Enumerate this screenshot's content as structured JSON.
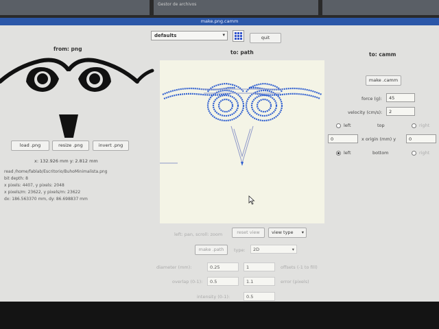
{
  "background_window": {
    "title": "Gestor de archivos"
  },
  "window": {
    "title": "make.png.camm"
  },
  "toolbar": {
    "preset": "defaults",
    "quit_label": "quit"
  },
  "from_panel": {
    "heading": "from: png",
    "load_label": "load .png",
    "resize_label": "resize .png",
    "invert_label": "invert .png",
    "coords": "x: 132.926 mm  y: 2.812 mm",
    "info": [
      "read /home/fablab/Escritorio/BuhoMinimalista.png",
      "bit depth: 8",
      "x pixels: 4407, y pixels: 2048",
      "x pixels/m: 23622, y pixels/m: 23622",
      "dx: 186.563370 mm, dy: 86.698837 mm"
    ]
  },
  "path_panel": {
    "heading": "to: path",
    "hint": "left: pan, scroll: zoom",
    "reset_view_label": "reset view",
    "view_type_label": "view type",
    "make_path_label": "make .path",
    "type_label": "type:",
    "type_value": "2D",
    "diameter_label": "diameter (mm):",
    "diameter_value": "0.25",
    "offsets_value": "1",
    "offsets_label": "offsets (-1 to fill)",
    "overlap_label": "overlap (0-1):",
    "overlap_value": "0.5",
    "error_value": "1.1",
    "error_label": "error (pixels)",
    "intensity_label": "intensity (0-1):",
    "intensity_value": "0.5"
  },
  "camm_panel": {
    "heading": "to: camm",
    "make_camm_label": "make .camm",
    "force_label": "force (g):",
    "force_value": "45",
    "velocity_label": "velocity (cm/s):",
    "velocity_value": "2",
    "left_top": "left",
    "top": "top",
    "right_top": "right",
    "origin_x": "0",
    "origin_label": "x  origin (mm)  y",
    "origin_y": "0",
    "left_bottom": "left",
    "bottom": "bottom",
    "right_bottom": "right"
  },
  "colors": {
    "titlebar": "#2b57a8",
    "path_stroke": "#2f5fd0",
    "canvas": "#f4f4e6"
  }
}
